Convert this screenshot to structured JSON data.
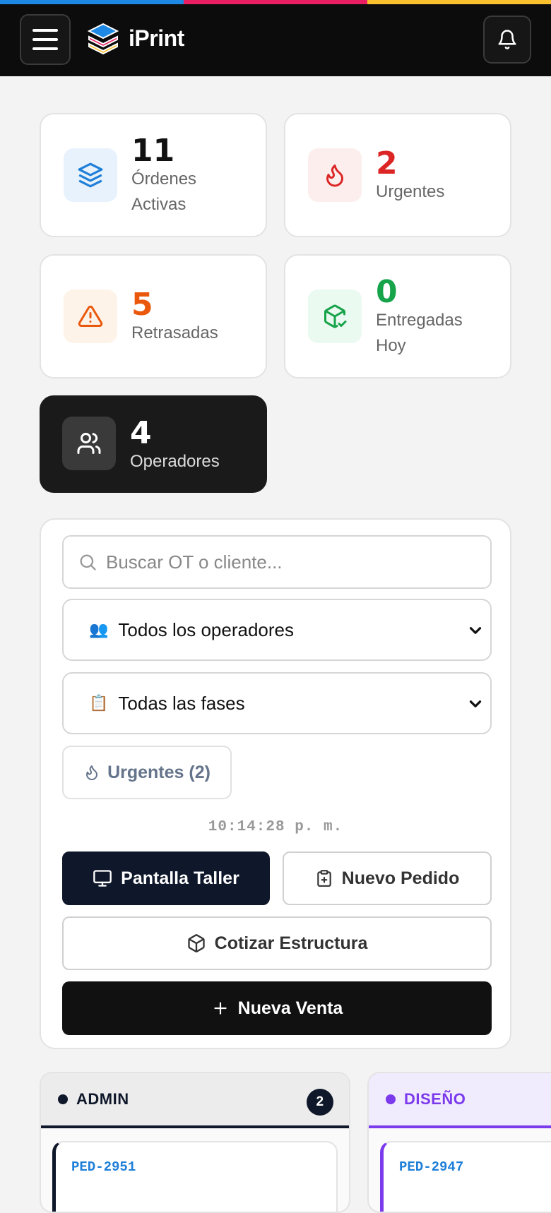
{
  "colors": {
    "stripe": [
      "#1e88e5",
      "#e91e63",
      "#fbc02d"
    ],
    "accent_blue": "#1f7fd8",
    "accent_red": "#dc2626",
    "accent_orange": "#ea580c",
    "accent_green": "#16a34a",
    "accent_purple": "#7c3aed"
  },
  "header": {
    "app_name": "iPrint",
    "menu_icon": "hamburger-icon",
    "bell_icon": "bell-icon"
  },
  "stats": [
    {
      "value": "11",
      "label": "Órdenes Activas",
      "icon": "layers-icon"
    },
    {
      "value": "2",
      "label": "Urgentes",
      "icon": "flame-icon"
    },
    {
      "value": "5",
      "label": "Retrasadas",
      "icon": "warning-icon"
    },
    {
      "value": "0",
      "label": "Entregadas Hoy",
      "icon": "package-check-icon"
    },
    {
      "value": "4",
      "label": "Operadores",
      "icon": "users-icon"
    }
  ],
  "filters": {
    "search_placeholder": "Buscar OT o cliente...",
    "operator_emoji": "👥",
    "operator_value": "Todos los operadores",
    "phase_emoji": "📋",
    "phase_value": "Todas las fases",
    "urgent_chip": "Urgentes (2)"
  },
  "clock": "10:14:28 p. m.",
  "actions": {
    "workshop_screen": "Pantalla Taller",
    "new_order": "Nuevo Pedido",
    "quote_structure": "Cotizar Estructura",
    "new_sale": "Nueva Venta"
  },
  "board": [
    {
      "title": "ADMIN",
      "count": "2",
      "first_order": "PED-2951"
    },
    {
      "title": "DISEÑO",
      "first_order": "PED-2947"
    }
  ]
}
